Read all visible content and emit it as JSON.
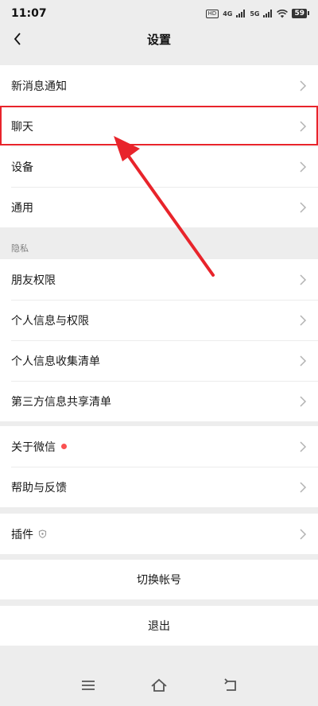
{
  "status": {
    "time": "11:07",
    "hd_label": "HD",
    "net_a": "4G",
    "net_b": "5G",
    "battery": "59"
  },
  "header": {
    "title": "设置"
  },
  "groups": {
    "g1": [
      "新消息通知",
      "聊天",
      "设备",
      "通用"
    ],
    "privacy_label": "隐私",
    "g2": [
      "朋友权限",
      "个人信息与权限",
      "个人信息收集清单",
      "第三方信息共享清单"
    ],
    "g3": [
      "关于微信",
      "帮助与反馈"
    ],
    "g4": [
      "插件"
    ]
  },
  "actions": {
    "switch_account": "切换帐号",
    "logout": "退出"
  },
  "colors": {
    "highlight": "#e8242b",
    "background": "#ededed",
    "badge": "#fa5151"
  },
  "icons": [
    "back-arrow-icon",
    "chevron-right-icon",
    "shield-icon",
    "menu-icon",
    "home-icon",
    "back-nav-icon"
  ]
}
